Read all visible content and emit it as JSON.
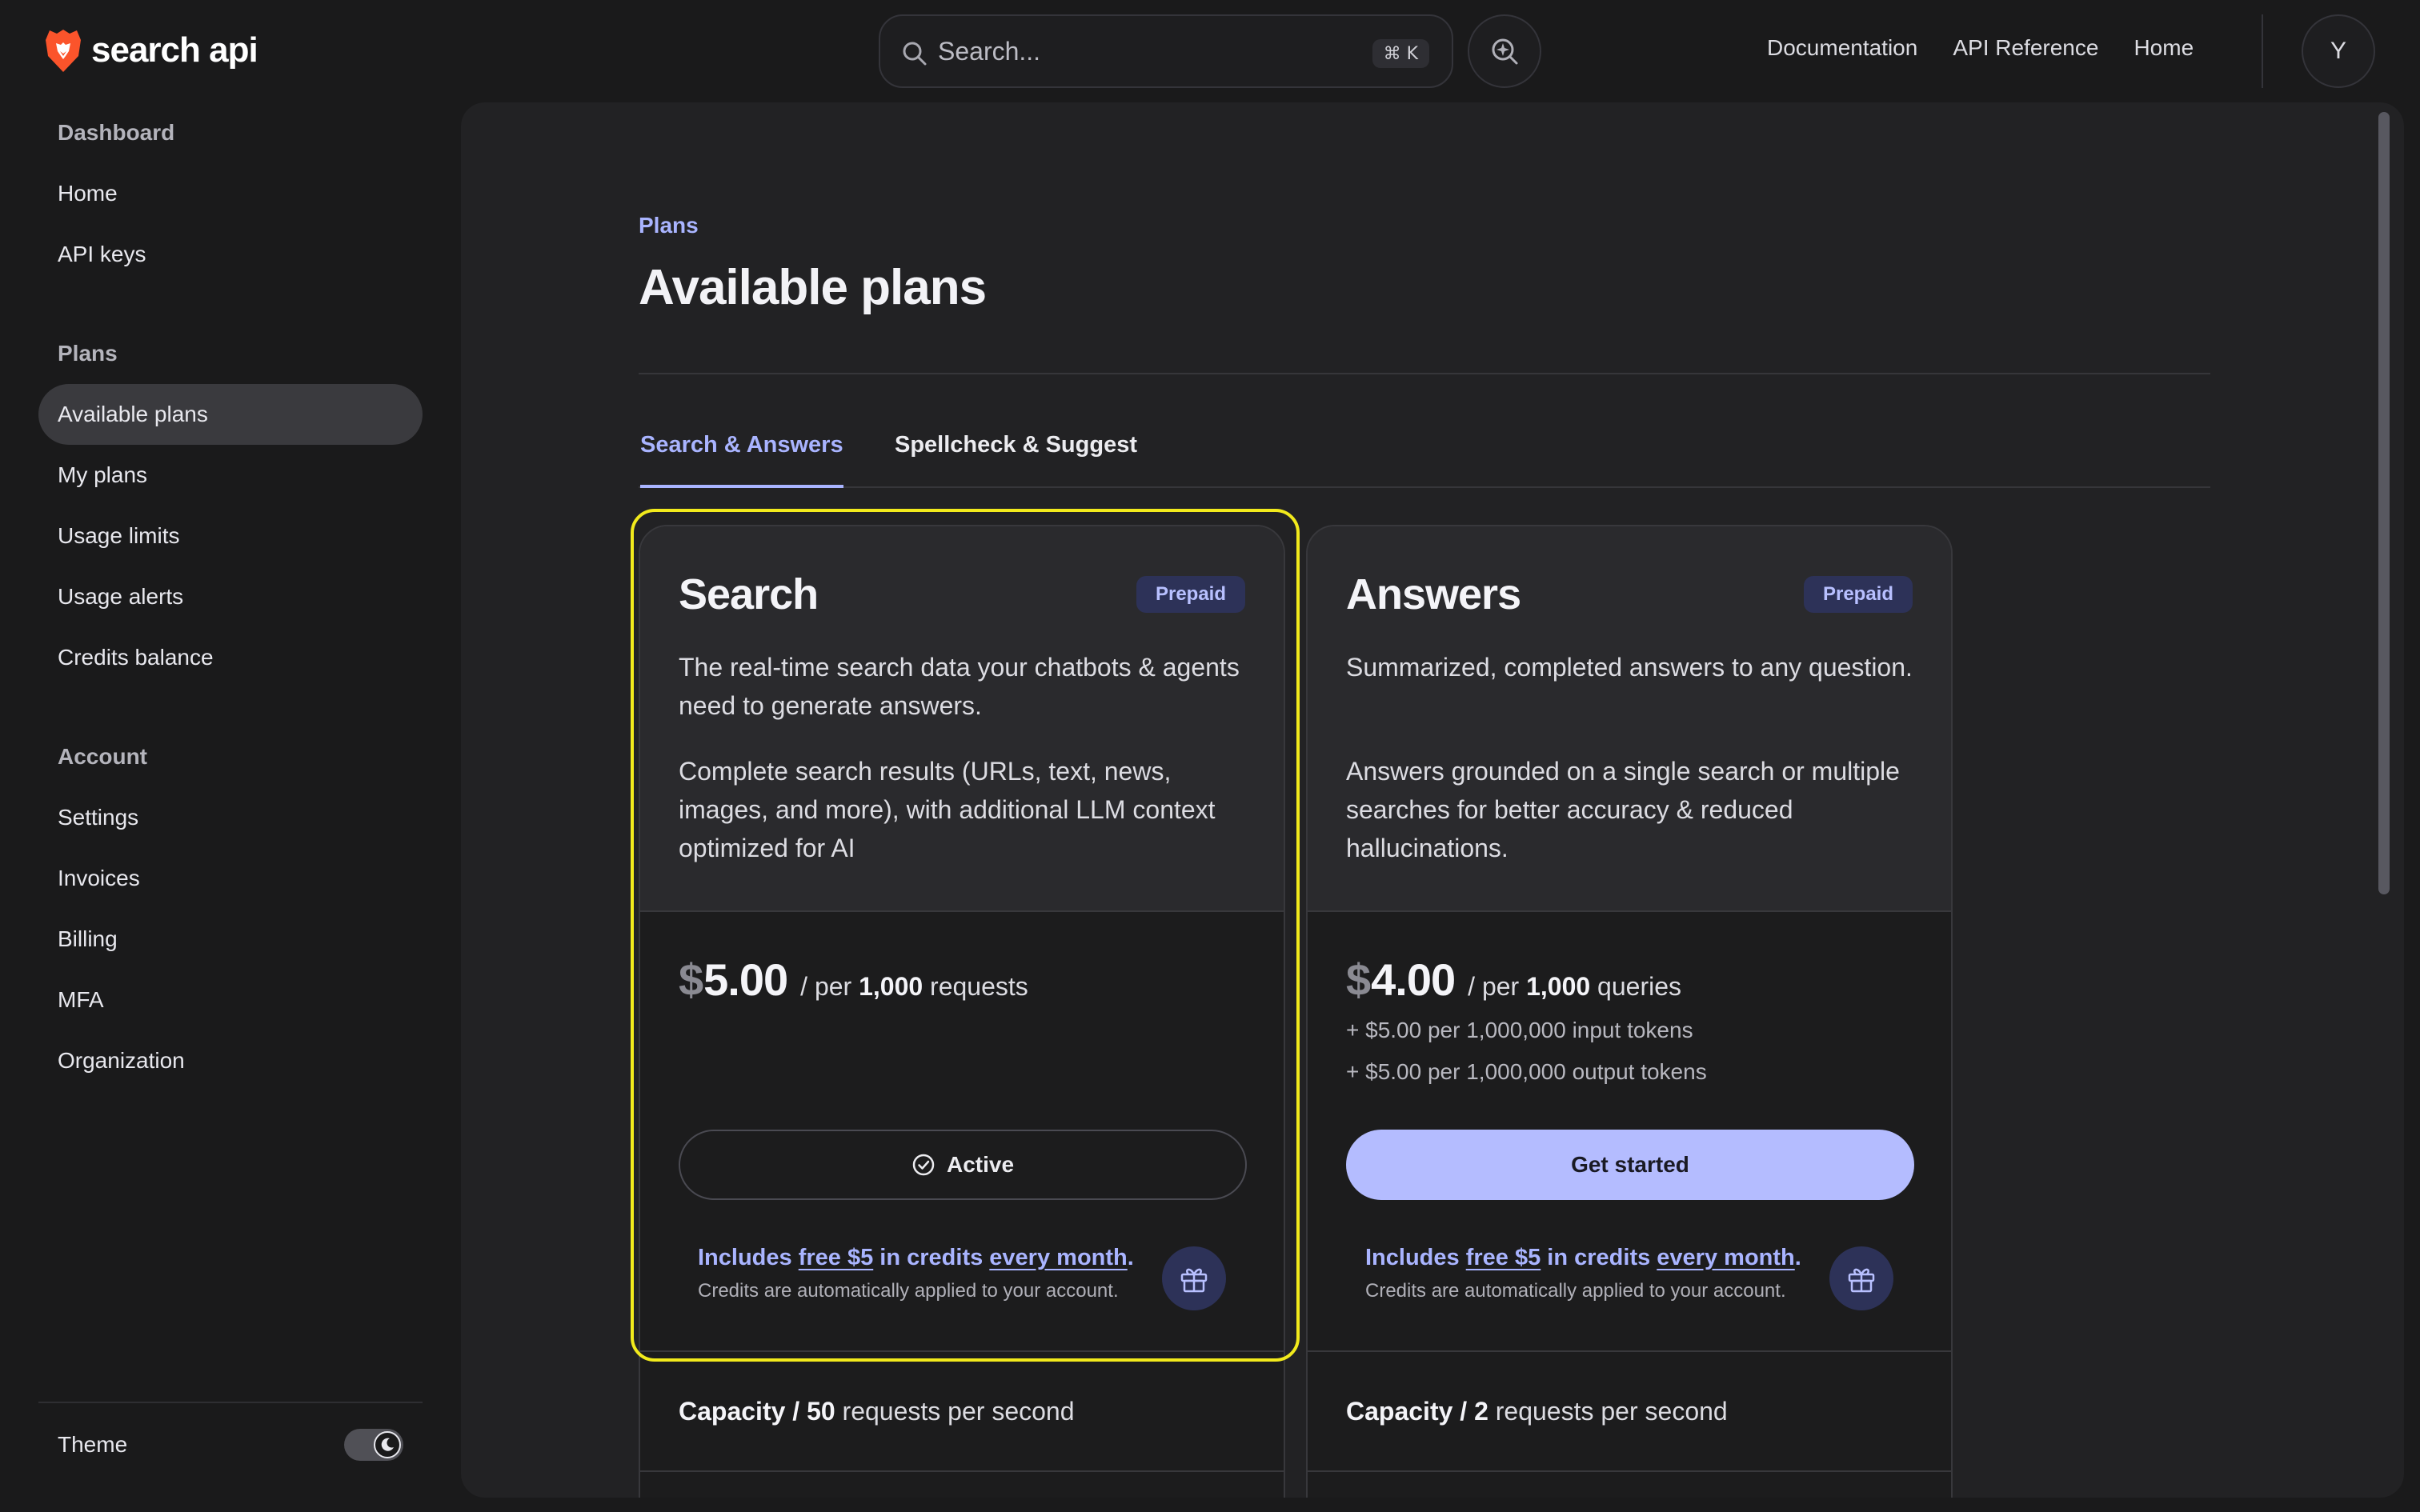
{
  "brand": {
    "name": "search api"
  },
  "search": {
    "placeholder": "Search...",
    "shortcut": "⌘ K"
  },
  "top_nav": [
    "Documentation",
    "API Reference",
    "Home"
  ],
  "user": {
    "initial": "Y"
  },
  "sidebar": {
    "sections": [
      {
        "label": "Dashboard",
        "items": [
          "Home",
          "API keys"
        ]
      },
      {
        "label": "Plans",
        "items": [
          "Available plans",
          "My plans",
          "Usage limits",
          "Usage alerts",
          "Credits balance"
        ]
      },
      {
        "label": "Account",
        "items": [
          "Settings",
          "Invoices",
          "Billing",
          "MFA",
          "Organization"
        ]
      }
    ],
    "active_item": "Available plans",
    "theme_label": "Theme"
  },
  "page": {
    "breadcrumb": "Plans",
    "title": "Available plans",
    "tabs": [
      "Search & Answers",
      "Spellcheck & Suggest"
    ],
    "active_tab": "Search & Answers"
  },
  "plans": [
    {
      "name": "Search",
      "badge": "Prepaid",
      "desc1": "The real-time search data your chatbots & agents need to generate answers.",
      "desc2": "Complete search results (URLs, text, news, images, and more), with additional LLM context optimized for AI",
      "price_currency": "$",
      "price_amount": "5.00",
      "price_per": "/ per",
      "price_qty": "1,000",
      "price_unit": "requests",
      "extras": [],
      "button": "Active",
      "credits_includes": "Includes",
      "credits_amount": "free $5",
      "credits_mid": "in credits",
      "credits_period": "every month",
      "credits_end": ".",
      "credits_note": "Credits are automatically applied to your account.",
      "capacity_label": "Capacity",
      "capacity_sep": "/",
      "capacity_value": "50",
      "capacity_unit": "requests per second"
    },
    {
      "name": "Answers",
      "badge": "Prepaid",
      "desc1": "Summarized, completed answers to any question.",
      "desc2": "Answers grounded on a single search or multiple searches for better accuracy & reduced hallucinations.",
      "price_currency": "$",
      "price_amount": "4.00",
      "price_per": "/ per",
      "price_qty": "1,000",
      "price_unit": "queries",
      "extras": [
        "+ $5.00 per 1,000,000 input tokens",
        "+ $5.00 per 1,000,000 output tokens"
      ],
      "button": "Get started",
      "credits_includes": "Includes",
      "credits_amount": "free $5",
      "credits_mid": "in credits",
      "credits_period": "every month",
      "credits_end": ".",
      "credits_note": "Credits are automatically applied to your account.",
      "capacity_label": "Capacity",
      "capacity_sep": "/",
      "capacity_value": "2",
      "capacity_unit": "requests per second"
    }
  ],
  "colors": {
    "accent": "#a9b4ff",
    "highlight": "#f2ea1c",
    "background": "#1a1a1b",
    "panel": "#222224"
  }
}
